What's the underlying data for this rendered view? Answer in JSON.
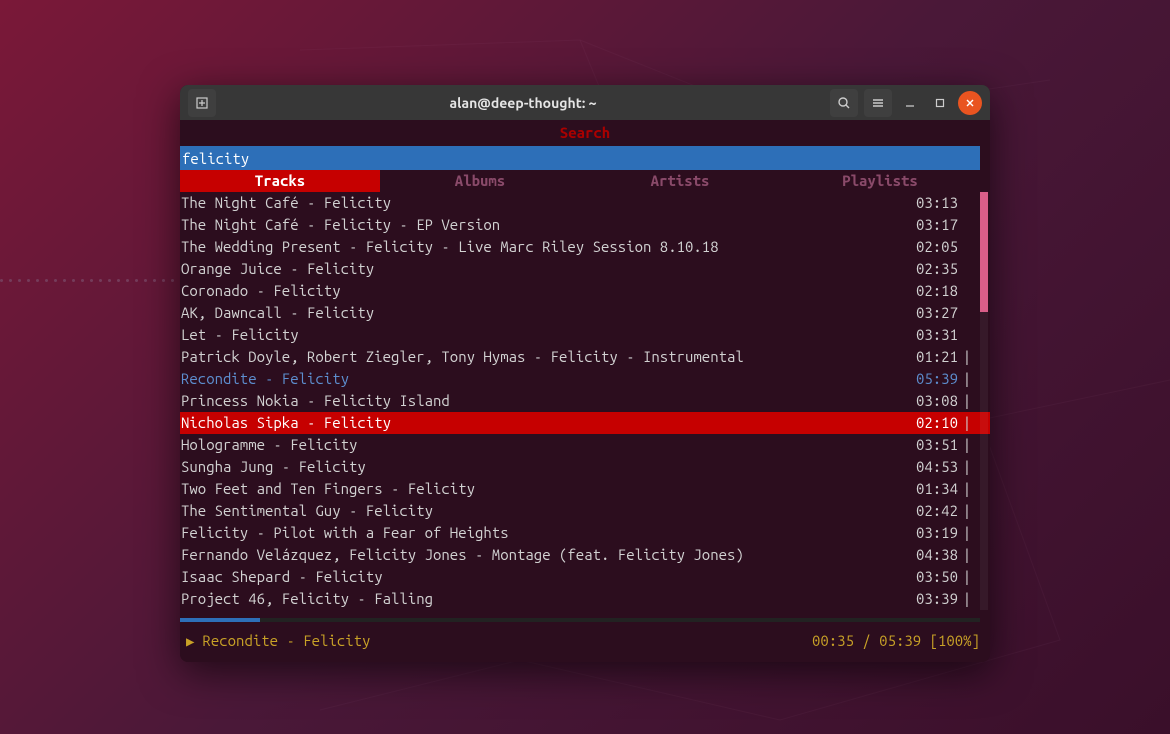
{
  "window": {
    "title": "alan@deep-thought: ~"
  },
  "app": {
    "search_title": "Search",
    "search_value": "felicity",
    "tabs": [
      {
        "label": "Tracks",
        "active": true
      },
      {
        "label": "Albums",
        "active": false
      },
      {
        "label": "Artists",
        "active": false
      },
      {
        "label": "Playlists",
        "active": false
      }
    ],
    "tracks": [
      {
        "title": "The Night Café - Felicity",
        "duration": "03:13",
        "mark": "",
        "playing": false,
        "selected": false
      },
      {
        "title": "The Night Café - Felicity - EP Version",
        "duration": "03:17",
        "mark": "",
        "playing": false,
        "selected": false
      },
      {
        "title": "The Wedding Present - Felicity - Live Marc Riley Session 8.10.18",
        "duration": "02:05",
        "mark": "",
        "playing": false,
        "selected": false
      },
      {
        "title": "Orange Juice - Felicity",
        "duration": "02:35",
        "mark": "",
        "playing": false,
        "selected": false
      },
      {
        "title": "Coronado - Felicity",
        "duration": "02:18",
        "mark": "",
        "playing": false,
        "selected": false
      },
      {
        "title": "AK, Dawncall - Felicity",
        "duration": "03:27",
        "mark": "",
        "playing": false,
        "selected": false
      },
      {
        "title": "Let - Felicity",
        "duration": "03:31",
        "mark": "",
        "playing": false,
        "selected": false
      },
      {
        "title": "Patrick Doyle, Robert Ziegler, Tony Hymas - Felicity - Instrumental",
        "duration": "01:21",
        "mark": "|",
        "playing": false,
        "selected": false
      },
      {
        "title": "Recondite - Felicity",
        "duration": "05:39",
        "mark": "|",
        "playing": true,
        "selected": false
      },
      {
        "title": "Princess Nokia - Felicity Island",
        "duration": "03:08",
        "mark": "|",
        "playing": false,
        "selected": false
      },
      {
        "title": "Nicholas Sipka - Felicity",
        "duration": "02:10",
        "mark": "|",
        "playing": false,
        "selected": true
      },
      {
        "title": "Hologramme - Felicity",
        "duration": "03:51",
        "mark": "|",
        "playing": false,
        "selected": false
      },
      {
        "title": "Sungha Jung - Felicity",
        "duration": "04:53",
        "mark": "|",
        "playing": false,
        "selected": false
      },
      {
        "title": "Two Feet and Ten Fingers - Felicity",
        "duration": "01:34",
        "mark": "|",
        "playing": false,
        "selected": false
      },
      {
        "title": "The Sentimental Guy - Felicity",
        "duration": "02:42",
        "mark": "|",
        "playing": false,
        "selected": false
      },
      {
        "title": "Felicity - Pilot with a Fear of Heights",
        "duration": "03:19",
        "mark": "|",
        "playing": false,
        "selected": false
      },
      {
        "title": "Fernando Velázquez, Felicity Jones - Montage (feat. Felicity Jones)",
        "duration": "04:38",
        "mark": "|",
        "playing": false,
        "selected": false
      },
      {
        "title": "Isaac Shepard - Felicity",
        "duration": "03:50",
        "mark": "|",
        "playing": false,
        "selected": false
      },
      {
        "title": "Project 46, Felicity - Falling",
        "duration": "03:39",
        "mark": "|",
        "playing": false,
        "selected": false
      }
    ],
    "status": {
      "now_playing": "Recondite - Felicity",
      "elapsed": "00:35",
      "total": "05:39",
      "volume": "100%",
      "progress_percent": 10
    }
  }
}
